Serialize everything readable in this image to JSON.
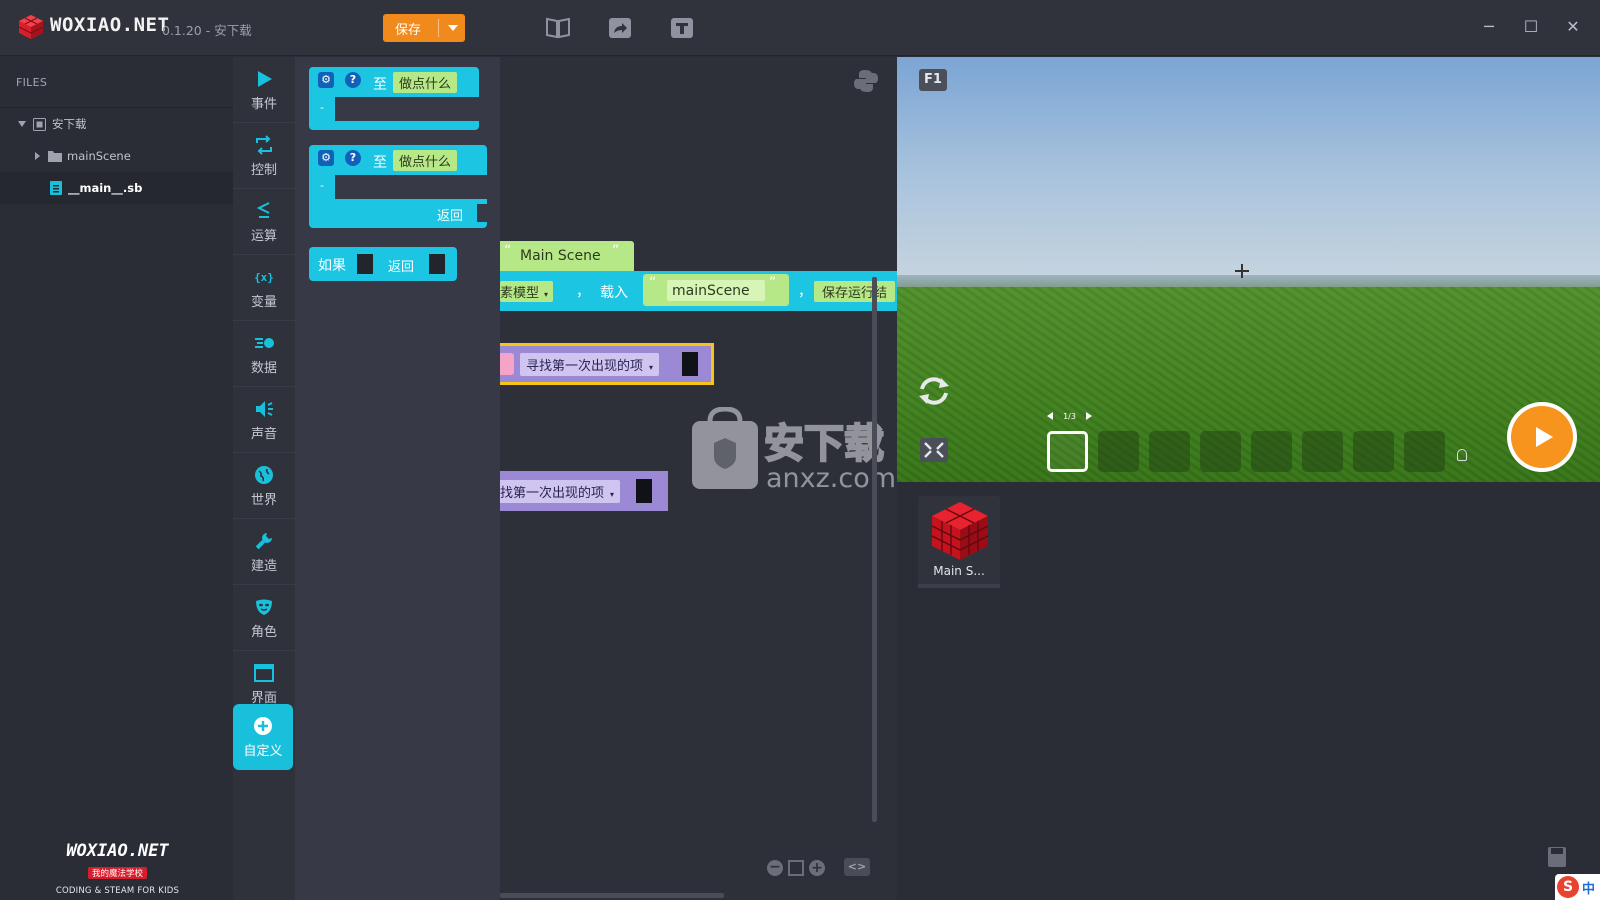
{
  "app": {
    "brand": "WOXIAO.NET",
    "version": "0.1.20 - 安下载",
    "save_label": "保存",
    "accent": "#19c0dc",
    "save_color": "#f08a1c"
  },
  "toolbar": {
    "icons": [
      "book-icon",
      "share-icon",
      "text-icon"
    ]
  },
  "window": {
    "minimize": "─",
    "maximize": "☐",
    "close": "✕"
  },
  "files": {
    "title": "FILES",
    "tree": [
      {
        "label": "安下载",
        "icon": "project-icon",
        "expanded": true
      },
      {
        "label": "mainScene",
        "icon": "folder-icon",
        "expanded": false
      },
      {
        "label": "__main__.sb",
        "icon": "file-icon",
        "selected": true
      }
    ],
    "footer": {
      "brand": "WOXIAO.NET",
      "badge": "我的魔法学校",
      "tagline": "CODING & STEAM FOR KIDS"
    }
  },
  "categories": [
    {
      "label": "事件",
      "icon": "play-icon"
    },
    {
      "label": "控制",
      "icon": "loop-icon"
    },
    {
      "label": "运算",
      "icon": "compare-icon"
    },
    {
      "label": "变量",
      "icon": "variable-icon"
    },
    {
      "label": "数据",
      "icon": "data-icon"
    },
    {
      "label": "声音",
      "icon": "speaker-icon"
    },
    {
      "label": "世界",
      "icon": "globe-icon"
    },
    {
      "label": "建造",
      "icon": "wrench-icon"
    },
    {
      "label": "角色",
      "icon": "mask-icon"
    },
    {
      "label": "界面",
      "icon": "window-icon"
    },
    {
      "label": "自定义",
      "icon": "plus-circle-icon",
      "active": true
    }
  ],
  "flyout": {
    "block1": {
      "to": "至",
      "name": "做点什么"
    },
    "block2": {
      "to": "至",
      "name": "做点什么",
      "return": "返回"
    },
    "block3": {
      "if": "如果",
      "return": "返回"
    }
  },
  "workspace": {
    "scene_string": "Main Scene",
    "row2_left": "素模型",
    "row2_comma": "，",
    "row2_load": "载入",
    "row2_string": "mainScene",
    "row2_comma2": "，",
    "row2_right": "保存运行结",
    "find_block_1": "寻找第一次出现的项",
    "find_block_2": "找第一次出现的项"
  },
  "stage": {
    "f1_label": "F1",
    "page_indicator": "1/3",
    "slot_count": 8,
    "selected_slot": 0
  },
  "assets": [
    {
      "name": "Main S...",
      "icon": "cube-icon"
    }
  ]
}
